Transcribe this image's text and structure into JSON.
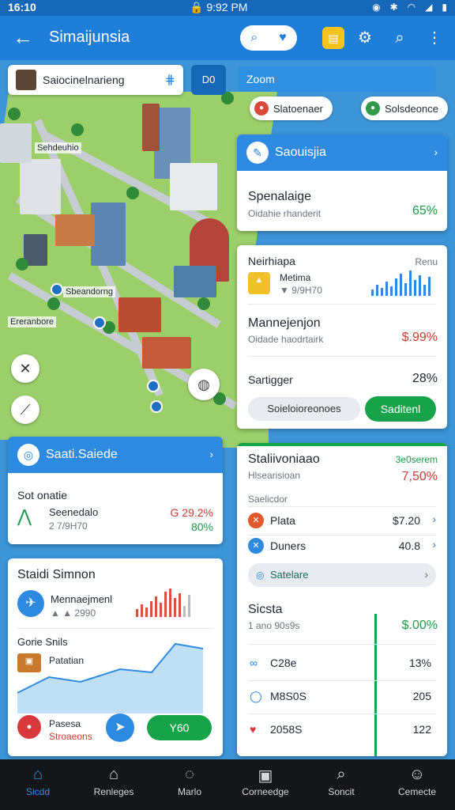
{
  "status": {
    "time": "16:10",
    "center": "9:92 PM"
  },
  "appbar": {
    "title": "Simaijunsia",
    "back_icon": "arrow-left-icon"
  },
  "search": {
    "text": "Saiocinelnarieng"
  },
  "map_button": {
    "label": "D0"
  },
  "zoom": {
    "label": "Zoom"
  },
  "chips": [
    {
      "label": "Slatoenaer",
      "color": "#d94a3b"
    },
    {
      "label": "Solsdeonce",
      "color": "#2e9a4a"
    }
  ],
  "map": {
    "labels": [
      "Sehdeuhio",
      "Sbeandorng",
      "Ereranbore"
    ]
  },
  "card_summary": {
    "header": "Saouisjia",
    "title": "Spenalaige",
    "subtitle": "Oidahie rhanderit",
    "value": "65%"
  },
  "card_detail": {
    "title": "Neirhiapa",
    "corner": "Renu",
    "item_title": "Metima",
    "item_sub": "▼ 9/9H70",
    "row2_title": "Mannejenjon",
    "row2_sub": "Oidade haodrtairk",
    "row2_value": "$.99%",
    "row3_title": "Sartigger",
    "row3_value": "28%",
    "btn_secondary": "Soieloioreonoes",
    "btn_primary": "Saditenl"
  },
  "card_left1": {
    "header": "Saati.Saiede",
    "title": "Sot onatie",
    "item_title": "Seenedalo",
    "item_sub": "2 7/9H70",
    "value1": "G 29.2%",
    "value2": "80%"
  },
  "card_left2": {
    "title": "Staidi Simnon",
    "item_title": "Mennaejmenl",
    "item_sub": "▲ ▲ 2990",
    "chart_title": "Gorie Snils",
    "chart_label": "Patatian",
    "footer_title": "Pasesa",
    "footer_sub": "Stroaeons",
    "footer_btn": "Y60"
  },
  "card_right2": {
    "title": "Staliivoniaao",
    "subtitle": "Hlsearisioan",
    "badge": "3e0serem",
    "value": "7,50%",
    "section": "Saelicdor",
    "rows": [
      {
        "label": "Plata",
        "value": "$7.20",
        "color": "#e2572c"
      },
      {
        "label": "Duners",
        "value": "40.8",
        "color": "#2d8ae0"
      }
    ],
    "select_label": "Satelare",
    "stats_title": "Sicsta",
    "stats_sub": "1 ano 90s9s",
    "stats_value": "$.00%",
    "list": [
      {
        "label": "C28e",
        "value": "13%"
      },
      {
        "label": "M8S0S",
        "value": "205"
      },
      {
        "label": "2058S",
        "value": "122"
      }
    ]
  },
  "nav": [
    {
      "label": "Sicdd",
      "icon": "home-icon",
      "active": true
    },
    {
      "label": "Renleges",
      "icon": "building-icon",
      "active": false
    },
    {
      "label": "Marlo",
      "icon": "chat-icon",
      "active": false
    },
    {
      "label": "Corneedge",
      "icon": "document-icon",
      "active": false
    },
    {
      "label": "Soncit",
      "icon": "search-icon",
      "active": false
    },
    {
      "label": "Cemecte",
      "icon": "profile-icon",
      "active": false
    }
  ]
}
